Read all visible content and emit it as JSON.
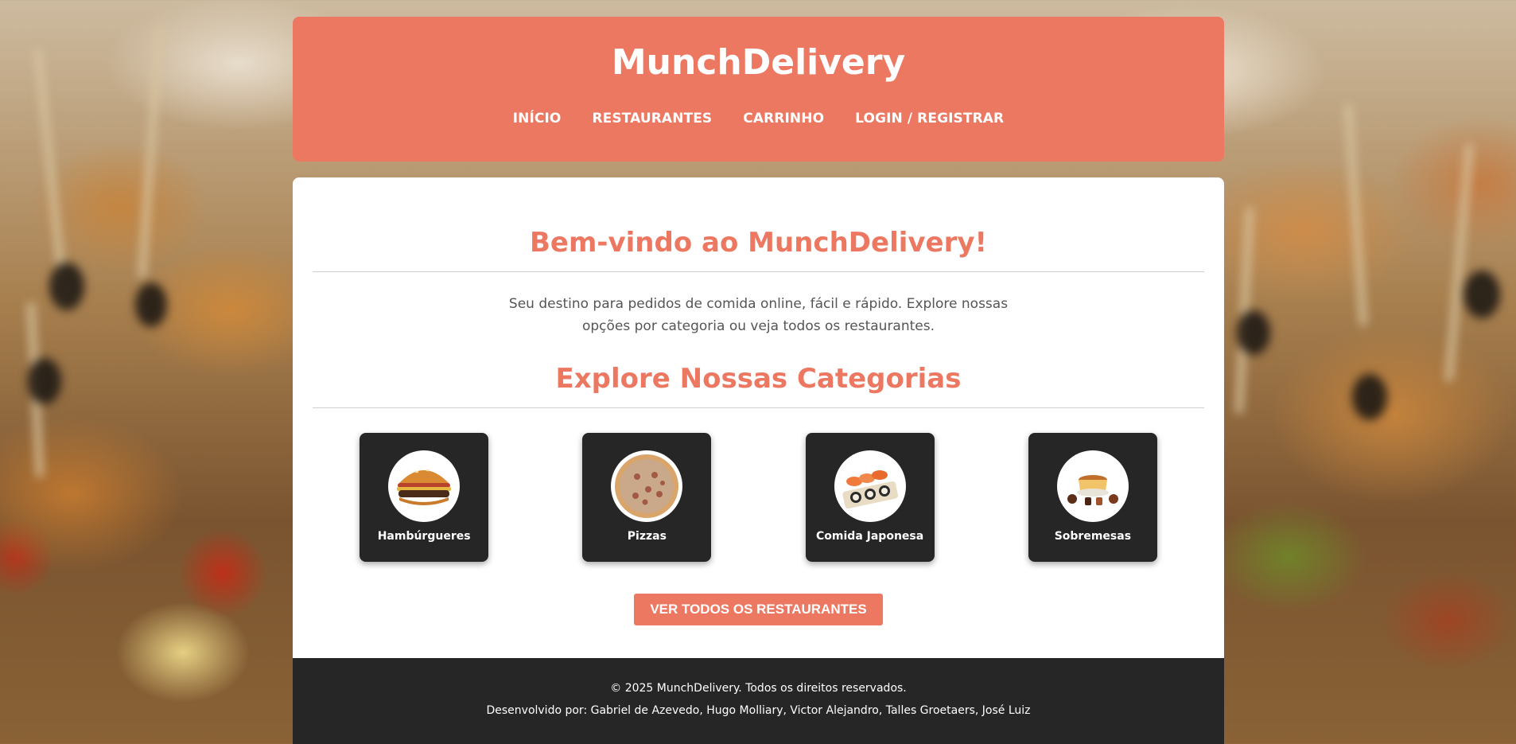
{
  "header": {
    "brand": "MunchDelivery",
    "nav": [
      {
        "label": "INÍCIO"
      },
      {
        "label": "RESTAURANTES"
      },
      {
        "label": "CARRINHO"
      },
      {
        "label": "LOGIN / REGISTRAR"
      }
    ]
  },
  "main": {
    "welcome_title": "Bem-vindo ao MunchDelivery!",
    "intro": "Seu destino para pedidos de comida online, fácil e rápido. Explore nossas opções por categoria ou veja todos os restaurantes.",
    "categories_title": "Explore Nossas Categorias",
    "categories": [
      {
        "label": "Hambúrgueres",
        "icon": "burger-icon"
      },
      {
        "label": "Pizzas",
        "icon": "pizza-icon"
      },
      {
        "label": "Comida Japonesa",
        "icon": "sushi-icon"
      },
      {
        "label": "Sobremesas",
        "icon": "dessert-icon"
      }
    ],
    "cta_label": "VER TODOS OS RESTAURANTES"
  },
  "footer": {
    "copyright": "© 2025 MunchDelivery. Todos os direitos reservados.",
    "credits": "Desenvolvido por: Gabriel de Azevedo, Hugo Molliary, Victor Alejandro, Talles Groetaers, José Luiz"
  },
  "colors": {
    "accent": "#ed7862",
    "dark": "#262626",
    "surface": "#ffffff"
  }
}
